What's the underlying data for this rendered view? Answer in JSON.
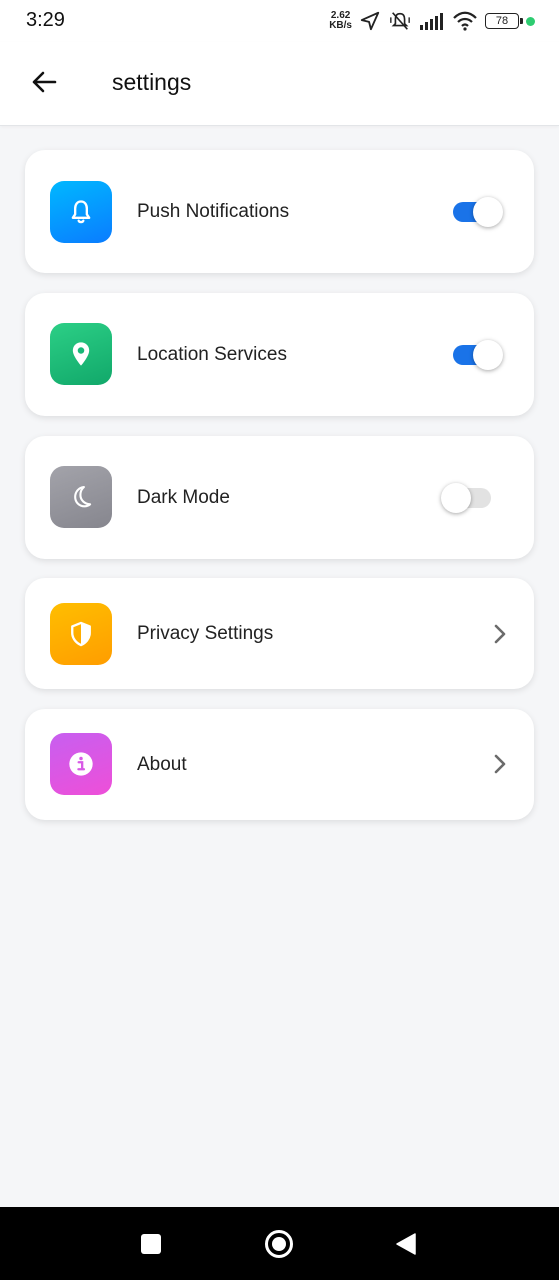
{
  "status_bar": {
    "time": "3:29",
    "net_speed_value": "2.62",
    "net_speed_unit": "KB/s",
    "battery": "78",
    "indicator_color": "#2ecc71"
  },
  "app_bar": {
    "title": "settings",
    "back_icon": "arrow-left-icon"
  },
  "settings": [
    {
      "label": "Push Notifications",
      "icon": "bell-icon",
      "gradient": [
        "#00b8ff",
        "#0a7cff"
      ],
      "control": "toggle",
      "enabled": true
    },
    {
      "label": "Location Services",
      "icon": "location-pin-icon",
      "gradient": [
        "#2ccf86",
        "#11a86a"
      ],
      "control": "toggle",
      "enabled": true
    },
    {
      "label": "Dark Mode",
      "icon": "moon-icon",
      "gradient": [
        "#a3a3aa",
        "#86868e"
      ],
      "control": "toggle",
      "enabled": false
    },
    {
      "label": "Privacy Settings",
      "icon": "shield-icon",
      "gradient": [
        "#ffbe00",
        "#ff9d00"
      ],
      "control": "chevron"
    },
    {
      "label": "About",
      "icon": "info-icon",
      "gradient": [
        "#c75ff0",
        "#ee4fd8"
      ],
      "control": "chevron"
    }
  ],
  "colors": {
    "toggle_on": "#1a73e8",
    "toggle_off": "#e2e2e2",
    "chevron": "#6b6b6b",
    "page_background": "#f5f6f8"
  },
  "nav_bar": {
    "buttons": [
      "square-recents-icon",
      "circle-home-icon",
      "triangle-back-icon"
    ]
  }
}
